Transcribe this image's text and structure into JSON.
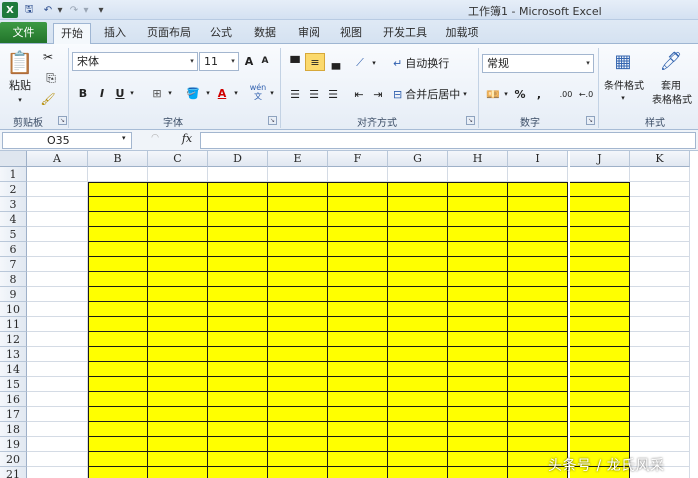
{
  "window": {
    "title": "工作簿1 - Microsoft Excel",
    "app_logo": "X"
  },
  "quick_access": {
    "save_icon": "save-icon",
    "undo_icon": "undo-icon",
    "redo_icon": "redo-icon"
  },
  "tabs": [
    {
      "label": "文件",
      "active": false
    },
    {
      "label": "开始",
      "active": true
    },
    {
      "label": "插入"
    },
    {
      "label": "页面布局"
    },
    {
      "label": "公式"
    },
    {
      "label": "数据"
    },
    {
      "label": "审阅"
    },
    {
      "label": "视图"
    },
    {
      "label": "开发工具"
    },
    {
      "label": "加载项"
    }
  ],
  "ribbon": {
    "clipboard": {
      "paste_label": "粘贴",
      "group_label": "剪贴板"
    },
    "font": {
      "name": "宋体",
      "size": "11",
      "bold": "B",
      "italic": "I",
      "underline": "U",
      "group_label": "字体",
      "grow": "A",
      "shrink": "A",
      "font_color_glyph": "A",
      "wen_glyph": "wén\n文"
    },
    "alignment": {
      "wrap_text": "自动换行",
      "merge_center": "合并后居中",
      "group_label": "对齐方式"
    },
    "number": {
      "format": "常规",
      "percent": "%",
      "comma": ",",
      "dec_inc": ".00",
      "group_label": "数字"
    },
    "styles": {
      "conditional_format": "条件格式",
      "apply_label_1": "套用",
      "apply_label_2": "表格格式",
      "group_label": "样式"
    }
  },
  "formula_bar": {
    "name_box": "O35",
    "fx": "fx",
    "value": ""
  },
  "sheet": {
    "columns": [
      "A",
      "B",
      "C",
      "D",
      "E",
      "F",
      "G",
      "H",
      "I",
      "J",
      "K"
    ],
    "rows": [
      "1",
      "2",
      "3",
      "4",
      "5",
      "6",
      "7",
      "8",
      "9",
      "10",
      "11",
      "12",
      "13",
      "14",
      "15",
      "16",
      "17",
      "18",
      "19",
      "20",
      "21"
    ],
    "fill_color": "#ffff00",
    "filled_range": {
      "from_col": "B",
      "to_col": "J",
      "from_row": 2,
      "to_row": 21
    }
  },
  "watermark": "头条号 / 龙氏风采"
}
